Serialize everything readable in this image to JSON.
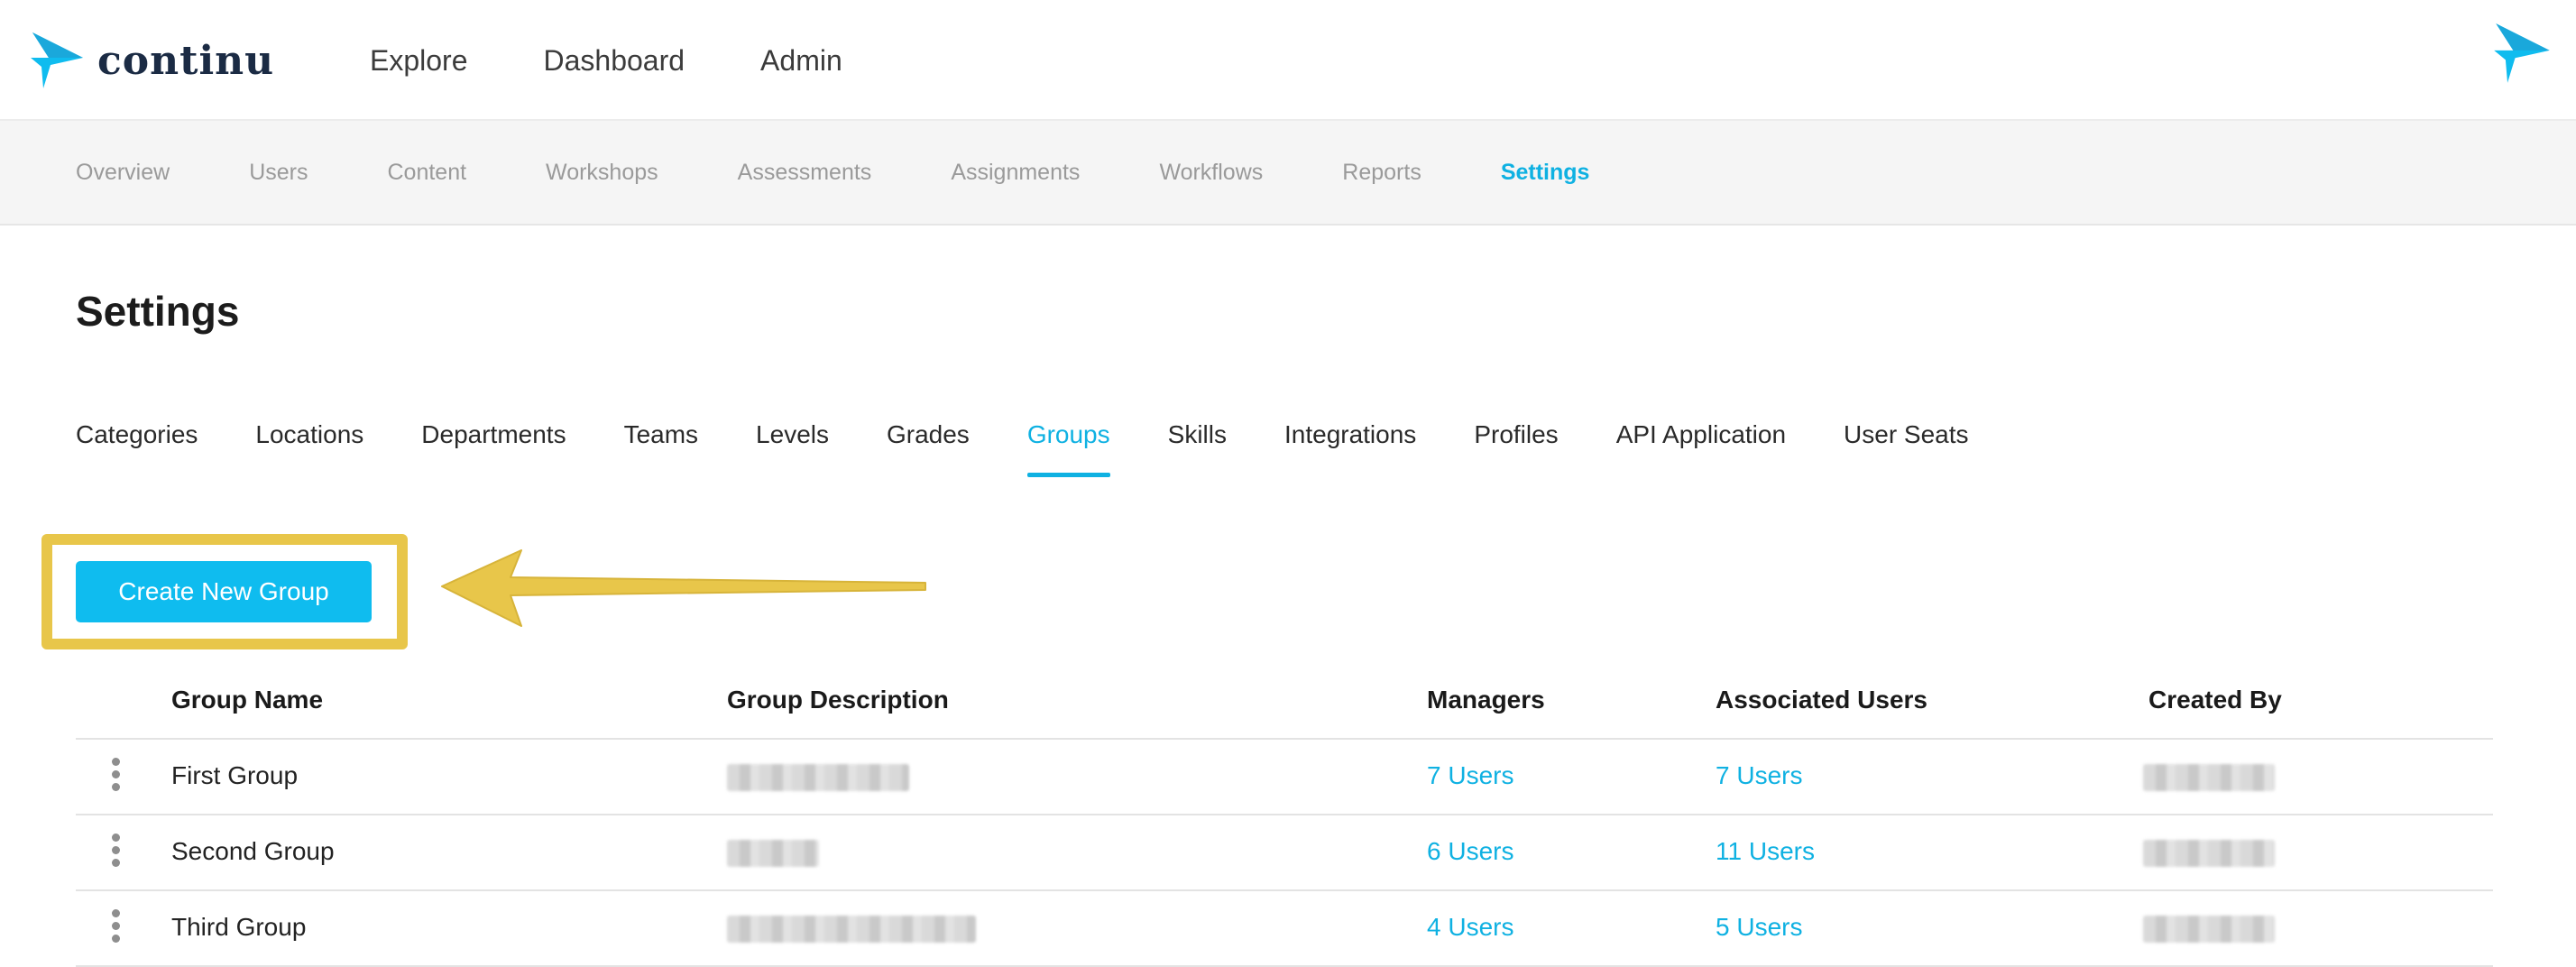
{
  "brand": {
    "name": "continu",
    "accent": "#0fbcef",
    "highlight": "#e8c64a"
  },
  "topnav": {
    "items": [
      "Explore",
      "Dashboard",
      "Admin"
    ]
  },
  "subnav": {
    "items": [
      "Overview",
      "Users",
      "Content",
      "Workshops",
      "Assessments",
      "Assignments",
      "Workflows",
      "Reports",
      "Settings"
    ],
    "active": "Settings"
  },
  "page": {
    "title": "Settings"
  },
  "tabs": {
    "items": [
      "Categories",
      "Locations",
      "Departments",
      "Teams",
      "Levels",
      "Grades",
      "Groups",
      "Skills",
      "Integrations",
      "Profiles",
      "API Application",
      "User Seats"
    ],
    "active": "Groups"
  },
  "actions": {
    "create_label": "Create New Group"
  },
  "table": {
    "headers": {
      "name": "Group Name",
      "description": "Group Description",
      "managers": "Managers",
      "associated": "Associated Users",
      "created_by": "Created By"
    },
    "rows": [
      {
        "name": "First Group",
        "managers": "7 Users",
        "associated": "7 Users"
      },
      {
        "name": "Second Group",
        "managers": "6 Users",
        "associated": "11 Users"
      },
      {
        "name": "Third Group",
        "managers": "4 Users",
        "associated": "5 Users"
      }
    ]
  },
  "icons": {
    "logo": "continu-logo-icon",
    "row_menu": "kebab-menu-icon",
    "annotation": "arrow-annotation-icon"
  }
}
